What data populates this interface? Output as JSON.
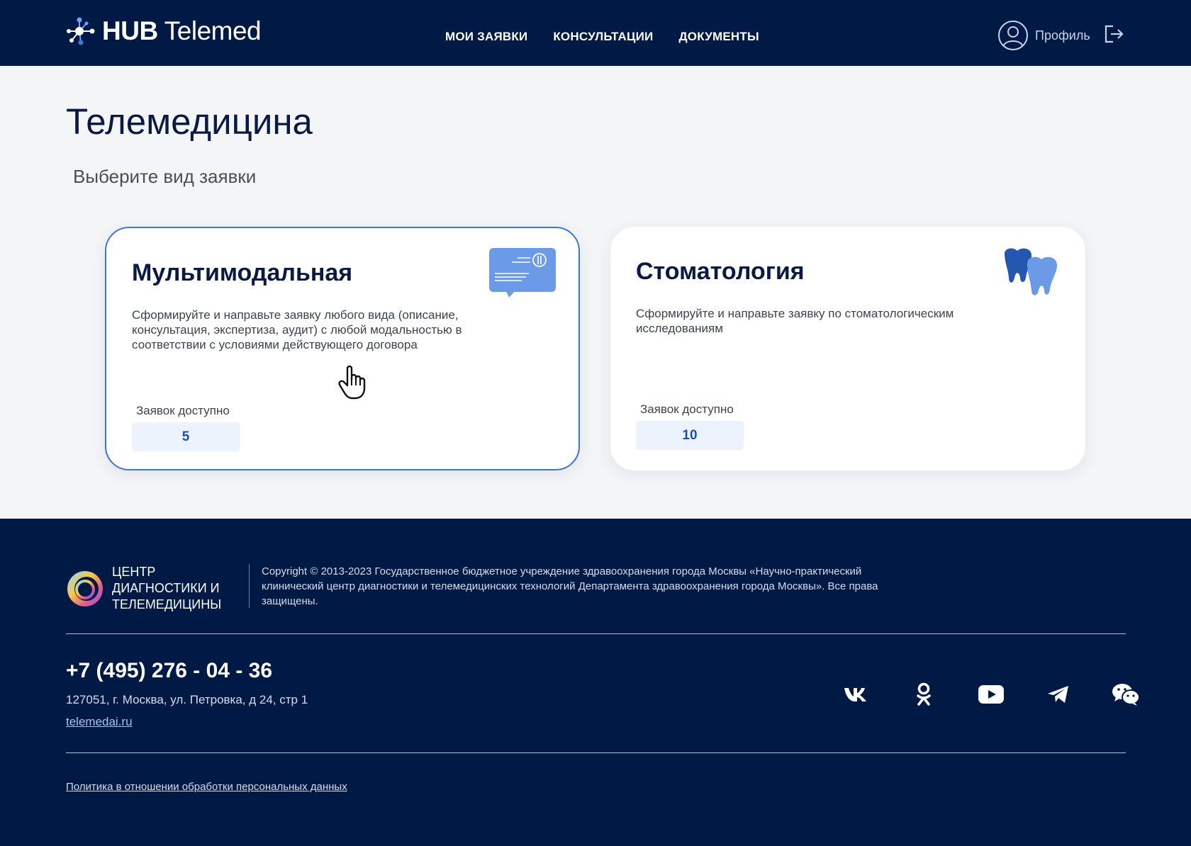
{
  "header": {
    "logo_bold": "HUB",
    "logo_regular": " Telemed",
    "nav": [
      {
        "label": "МОИ ЗАЯВКИ"
      },
      {
        "label": "КОНСУЛЬТАЦИИ"
      },
      {
        "label": "ДОКУМЕНТЫ"
      }
    ],
    "profile_label": "Профиль"
  },
  "main": {
    "title": "Телемедицина",
    "subtitle": "Выберите вид заявки",
    "cards": [
      {
        "title": "Мультимодальная",
        "description": "Сформируйте и направьте заявку любого вида (описание, консультация, экспертиза, аудит) с любой модальностью в соответствии с условиями действующего договора",
        "available_label": "Заявок доступно",
        "available_count": "5",
        "icon": "chat-document-icon",
        "selected": true
      },
      {
        "title": "Стоматология",
        "description": "Сформируйте и направьте заявку по стоматологическим исследованиям",
        "available_label": "Заявок доступно",
        "available_count": "10",
        "icon": "teeth-icon",
        "selected": false
      }
    ]
  },
  "footer": {
    "org_name": "Центр диагностики и телемедицины",
    "copyright": "Copyright © 2013-2023 Государственное бюджетное учреждение здравоохранения города Москвы «Научно-практический клинический центр диагностики и телемедицинских технологий Департамента здравоохранения города Москвы». Все права защищены.",
    "phone": "+7 (495) 276 - 04 - 36",
    "address": "127051, г. Москва, ул. Петровка, д 24, стр 1",
    "site": "telemedai.ru",
    "policy": "Политика в отношении обработки персональных данных",
    "socials": [
      "vk-icon",
      "odnoklassniki-icon",
      "youtube-icon",
      "telegram-icon",
      "wechat-icon"
    ]
  },
  "colors": {
    "header_bg": "#001a45",
    "accent": "#3b78d4",
    "count_bg": "#edf3fd",
    "count_text": "#1e4fa8"
  }
}
